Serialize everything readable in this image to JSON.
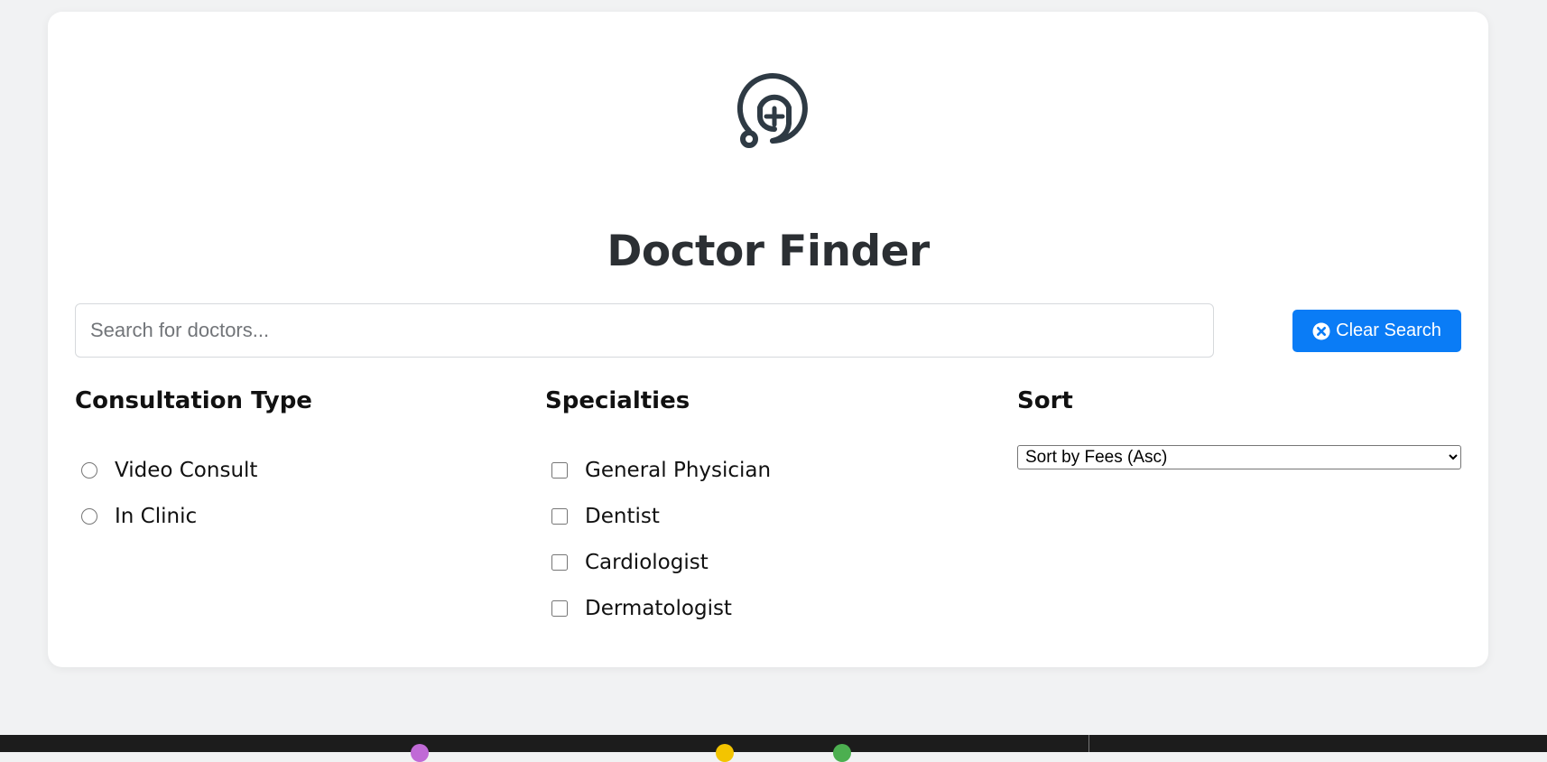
{
  "app": {
    "title": "Doctor Finder",
    "logo_icon": "stethoscope-medical-icon"
  },
  "search": {
    "placeholder": "Search for doctors...",
    "value": ""
  },
  "clear_button": {
    "label": "Clear Search",
    "icon": "circle-x-icon",
    "color": "#0a7cf6"
  },
  "consultation": {
    "title": "Consultation Type",
    "options": [
      {
        "label": "Video Consult",
        "selected": false
      },
      {
        "label": "In Clinic",
        "selected": false
      }
    ]
  },
  "specialties": {
    "title": "Specialties",
    "options": [
      {
        "label": "General Physician",
        "checked": false
      },
      {
        "label": "Dentist",
        "checked": false
      },
      {
        "label": "Cardiologist",
        "checked": false
      },
      {
        "label": "Dermatologist",
        "checked": false
      }
    ]
  },
  "sort": {
    "title": "Sort",
    "selected": "Sort by Fees (Asc)"
  },
  "colors": {
    "accent": "#0a7cf6",
    "title_text": "#2b2f33",
    "background": "#f1f2f3"
  }
}
